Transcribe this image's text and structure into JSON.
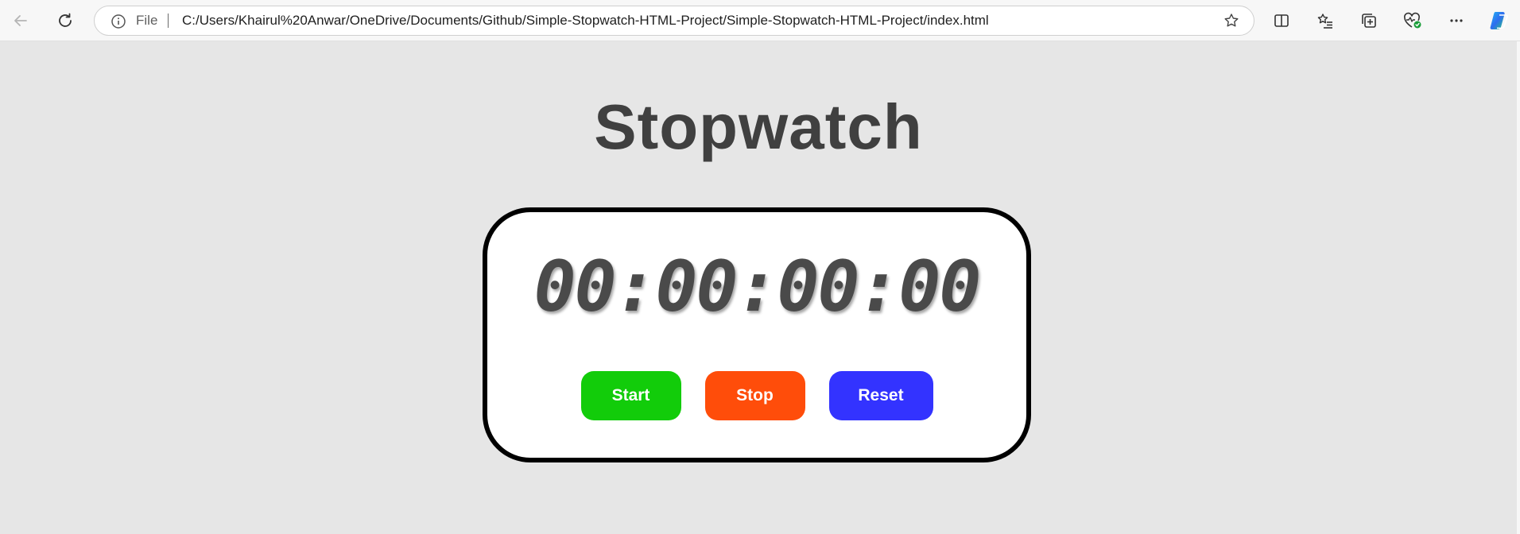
{
  "browser": {
    "address_bar": {
      "scheme_label": "File",
      "url": "C:/Users/Khairul%20Anwar/OneDrive/Documents/Github/Simple-Stopwatch-HTML-Project/Simple-Stopwatch-HTML-Project/index.html"
    },
    "icons": {
      "back": "back-arrow-icon",
      "reload": "reload-icon",
      "info": "info-icon",
      "favorite": "star-icon",
      "split_screen": "split-screen-icon",
      "favorites": "favorites-icon",
      "collections": "collections-icon",
      "browser_essentials": "heart-pulse-icon",
      "menu": "more-icon",
      "copilot": "copilot-icon"
    }
  },
  "page": {
    "title": "Stopwatch",
    "timer": "00:00:00:00",
    "buttons": {
      "start": "Start",
      "stop": "Stop",
      "reset": "Reset"
    }
  },
  "colors": {
    "page_background": "#e6e6e6",
    "start": "#12cc0a",
    "stop": "#ff4d0a",
    "reset": "#3333ff",
    "text": "#404040"
  }
}
